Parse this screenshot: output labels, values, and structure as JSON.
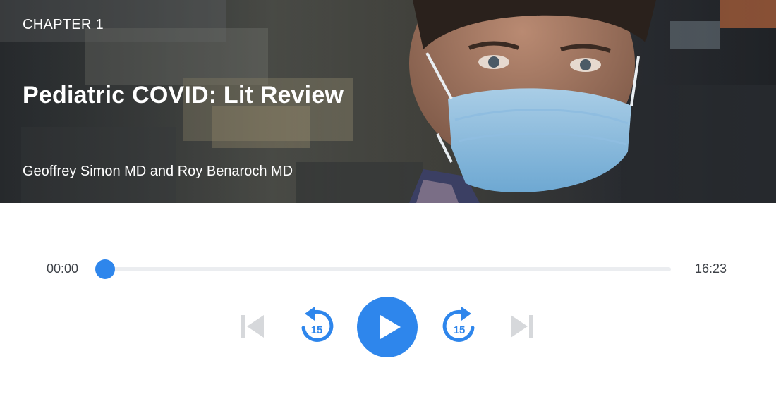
{
  "hero": {
    "chapter_label": "CHAPTER 1",
    "title": "Pediatric COVID: Lit Review",
    "authors": "Geoffrey Simon MD and Roy Benaroch MD",
    "image_description_icon": "masked-person-photo"
  },
  "player": {
    "elapsed": "00:00",
    "total": "16:23",
    "progress_fraction": 0.0,
    "accent_color": "#2e86ec",
    "disabled_color": "#d6d8db",
    "controls": {
      "previous_icon": "skip-previous-icon",
      "rewind_icon": "rewind-15-icon",
      "rewind_seconds": "15",
      "play_icon": "play-icon",
      "forward_icon": "forward-15-icon",
      "forward_seconds": "15",
      "next_icon": "skip-next-icon"
    }
  }
}
